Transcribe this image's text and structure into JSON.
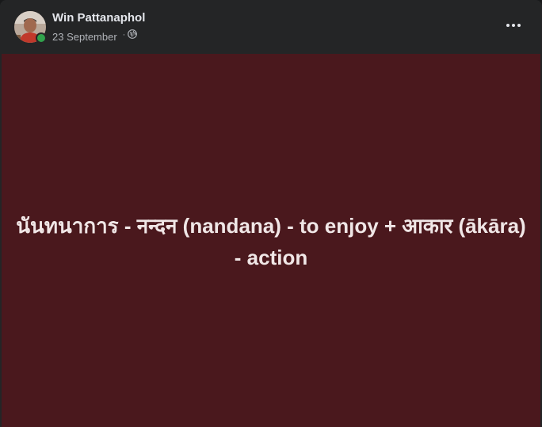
{
  "post": {
    "author_name": "Win Pattanaphol",
    "timestamp": "23 September",
    "separator": "·",
    "audience_icon": "globe-icon",
    "more_icon": "more-dots-icon",
    "status": "online",
    "card_text": "นันทนาการ - नन्दन (nandana) - to enjoy + आकार (ākāra) - action",
    "card_background": "#4a181d",
    "online_color": "#31a24c"
  }
}
